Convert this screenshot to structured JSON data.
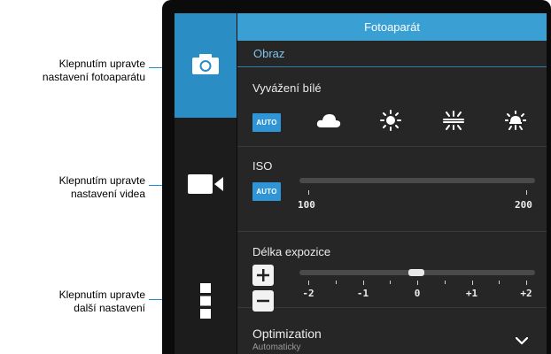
{
  "callouts": {
    "camera": {
      "line1": "Klepnutím upravte",
      "line2": "nastavení fotoaparátu"
    },
    "video": {
      "line1": "Klepnutím upravte",
      "line2": "nastavení videa"
    },
    "more": {
      "line1": "Klepnutím upravte",
      "line2": "další nastavení"
    }
  },
  "rail": {
    "items": [
      {
        "icon": "camera-icon",
        "active": true
      },
      {
        "icon": "video-camera-icon",
        "active": false
      },
      {
        "icon": "more-settings-icon",
        "active": false
      }
    ]
  },
  "panel": {
    "title": "Fotoaparát",
    "subheader": "Obraz",
    "white_balance": {
      "label": "Vyvážení bílé",
      "auto": "AUTO",
      "options": [
        "cloudy-icon",
        "daylight-icon",
        "fluorescent-icon",
        "incandescent-icon"
      ]
    },
    "iso": {
      "label": "ISO",
      "auto": "AUTO",
      "min_label": "100",
      "max_label": "200"
    },
    "exposure": {
      "label": "Délka expozice",
      "plus": "+",
      "minus": "−",
      "tick_labels": [
        "-2",
        "-1",
        "0",
        "+1",
        "+2"
      ],
      "value": 0
    },
    "optimization": {
      "label": "Optimization",
      "value": "Automaticky"
    }
  },
  "colors": {
    "accent": "#2a8ec4",
    "title_bar": "#3aa0d4",
    "panel_bg": "#262626"
  }
}
